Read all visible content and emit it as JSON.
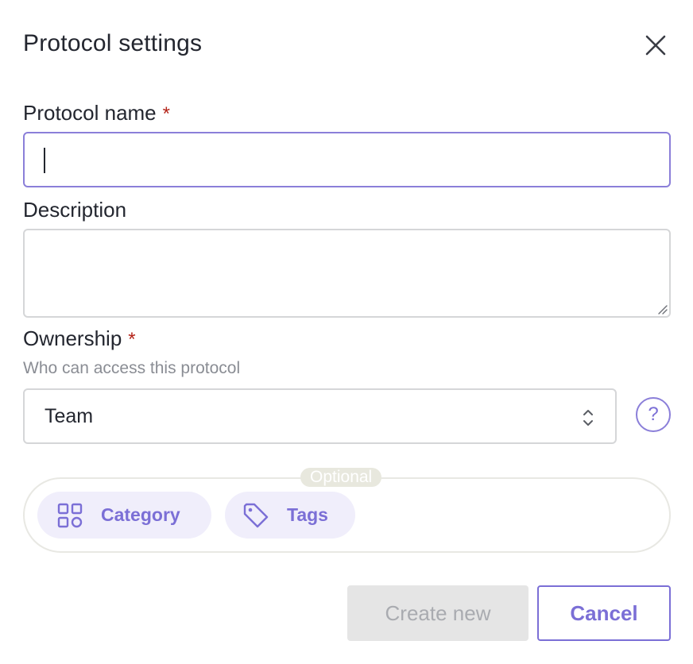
{
  "dialog": {
    "title": "Protocol settings",
    "close_icon": "close-icon"
  },
  "fields": {
    "protocol_name": {
      "label": "Protocol name",
      "required_mark": "*",
      "value": ""
    },
    "description": {
      "label": "Description",
      "value": ""
    },
    "ownership": {
      "label": "Ownership",
      "required_mark": "*",
      "hint": "Who can access this protocol",
      "selected": "Team",
      "help_symbol": "?"
    }
  },
  "optional": {
    "badge": "Optional",
    "chips": [
      {
        "label": "Category",
        "icon": "grid-icon"
      },
      {
        "label": "Tags",
        "icon": "tag-icon"
      }
    ]
  },
  "footer": {
    "create_label": "Create new",
    "cancel_label": "Cancel"
  },
  "colors": {
    "accent": "#7b6fd6",
    "required": "#b42318",
    "disabled_bg": "#e5e5e5",
    "chip_bg": "#f0eefb"
  }
}
